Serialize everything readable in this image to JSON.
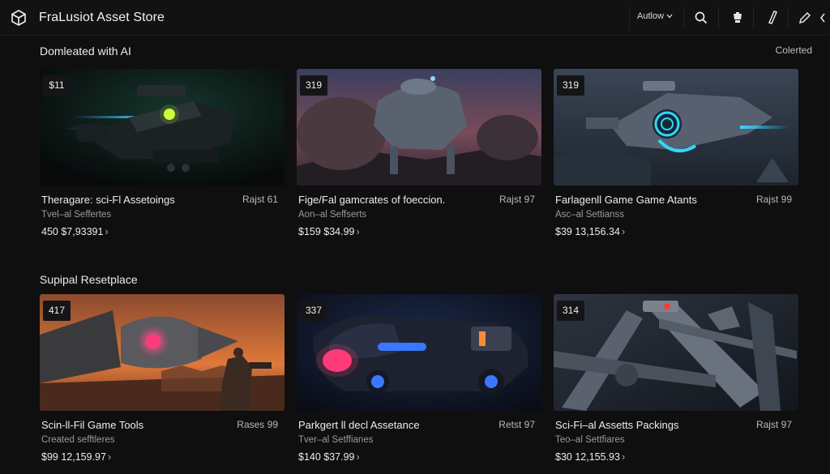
{
  "header": {
    "title": "FraLusiot Asset Store",
    "author_dropdown": "Autlow",
    "icons": [
      "unity-logo-icon",
      "search-icon",
      "cart-icon",
      "pen-icon",
      "edit-icon",
      "chevron-left-icon"
    ]
  },
  "sections": [
    {
      "title": "Domleated with AI",
      "action": "Colerted",
      "cards": [
        {
          "badge": "$11",
          "name": "Theragare: sci-Fl Assetoings",
          "rating": "Rajst 61",
          "publisher": "Tvel–al Seffertes",
          "price": "450  $7,93391",
          "chevron": "›"
        },
        {
          "badge": "319",
          "name": "Fige/Fal gamcrates of foeccion.",
          "rating": "Rajst 97",
          "publisher": "Aon–al Seffserts",
          "price": "$159  $34.99",
          "chevron": "›"
        },
        {
          "badge": "319",
          "name": "Farlagenll Game Game Atants",
          "rating": "Rajst 99",
          "publisher": "Asc–al Settianss",
          "price": "$39  13,156.34",
          "chevron": "›"
        }
      ]
    },
    {
      "title": "Supipal Resetplace",
      "action": "",
      "cards": [
        {
          "badge": "417",
          "name": "Scin-ll-Fil Game Tools",
          "rating": "Rases 99",
          "publisher": "Created sefftleres",
          "price": "$99  12,159.97",
          "chevron": "›"
        },
        {
          "badge": "337",
          "name": "Parkgert ll decl Assetance",
          "rating": "Retst 97",
          "publisher": "Tver–al Setffianes",
          "price": "$140  $37.99",
          "chevron": "›"
        },
        {
          "badge": "314",
          "name": "Sci-Fi–al Assetts Packings",
          "rating": "Rajst 97",
          "publisher": "Teo–al Settfiares",
          "price": "$30  12,155.93",
          "chevron": "›"
        }
      ]
    }
  ],
  "colors": {
    "background": "#0f0f10",
    "topbar": "#121213",
    "badge_bg": "#151517",
    "neon_cyan": "#35d5ff",
    "neon_pink": "#ff3a7a",
    "sunset_orange": "#e0783a"
  }
}
